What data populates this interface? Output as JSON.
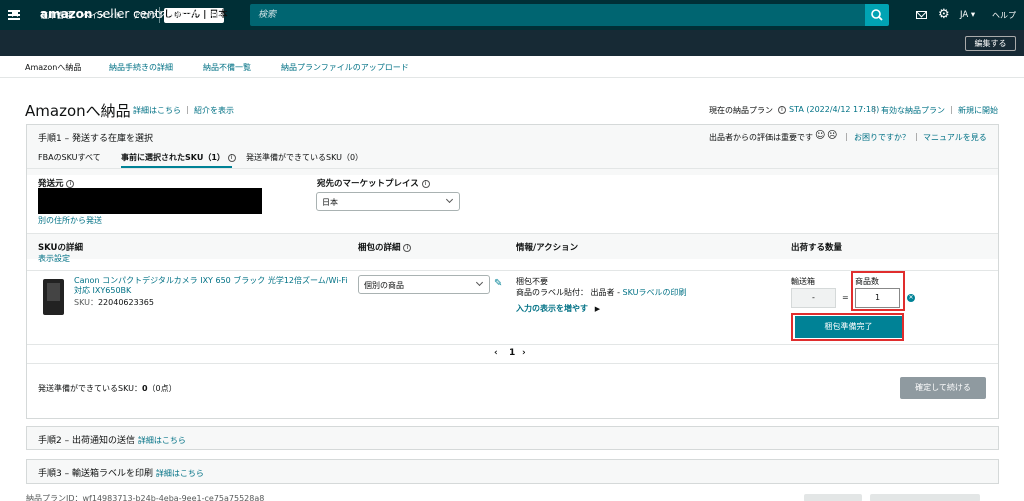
{
  "topbar": {
    "logo": "amazon",
    "logo_suffix": "seller central",
    "store": "しゅーん | 日本",
    "search_placeholder": "検索",
    "lang": "JA ▾",
    "help": "ヘルプ"
  },
  "nav": {
    "items": [
      "在庫管理",
      "ペイメント",
      "アカウント健全性",
      "評価"
    ],
    "edit": "編集する"
  },
  "subtabs": [
    "Amazonへ納品",
    "納品手続きの詳細",
    "納品不備一覧",
    "納品プランファイルのアップロード"
  ],
  "page": {
    "title": "Amazonへ納品",
    "link_details": "詳細はこちら",
    "link_intro": "紹介を表示",
    "plan_label": "現在の納品プラン",
    "plan_name": "STA (2022/4/12 17:18)",
    "active_plans": "有効な納品プラン",
    "new_start": "新規に開始"
  },
  "step1": {
    "title": "手順1 – 発送する在庫を選択",
    "feedback": "出品者からの評価は重要です",
    "need_help": "お困りですか？",
    "manual": "マニュアルを見る",
    "tabs": [
      "FBAのSKUすべて",
      "事前に選択されたSKU（1）",
      "発送準備ができているSKU（0）"
    ],
    "ship_from_label": "発送元",
    "ship_from_link": "別の住所から発送",
    "marketplace_label": "宛先のマーケットプレイス",
    "marketplace_value": "日本",
    "columns": {
      "sku": "SKUの詳細",
      "display_settings": "表示設定",
      "packing": "梱包の詳細",
      "info": "情報/アクション",
      "qty": "出荷する数量"
    },
    "item": {
      "name": "Canon コンパクトデジタルカメラ IXY 650 ブラック 光学12倍ズーム/Wi-Fi対応 IXY650BK",
      "sku_label": "SKU：",
      "sku": "22040623365",
      "packing_value": "個別の商品",
      "prep_none": "梱包不要",
      "label_text": "商品のラベル貼付： 出品者 -",
      "label_link": "SKUラベルの印刷",
      "more_inputs": "入力の表示を増やす",
      "box_label": "輸送箱",
      "units_label": "商品数",
      "box_value": "-",
      "equals": "=",
      "units_value": "1",
      "done_button": "梱包準備完了"
    },
    "page_number": "1",
    "ready_summary_prefix": "発送準備ができているSKU：",
    "ready_count": "0",
    "ready_units": "（0点）",
    "confirm_button": "確定して続ける"
  },
  "step2": {
    "title": "手順2 – 出荷通知の送信",
    "link": "詳細はこちら"
  },
  "step3": {
    "title": "手順3 – 輸送箱ラベルを印刷",
    "link": "詳細はこちら"
  },
  "footer": {
    "plan_id": "納品プランID：wf14983713-b24b-4eba-9ee1-ce75a75528a8"
  },
  "colors": {
    "topbar": "#002f36",
    "accent": "#008296",
    "highlight": "#e02d2d"
  }
}
